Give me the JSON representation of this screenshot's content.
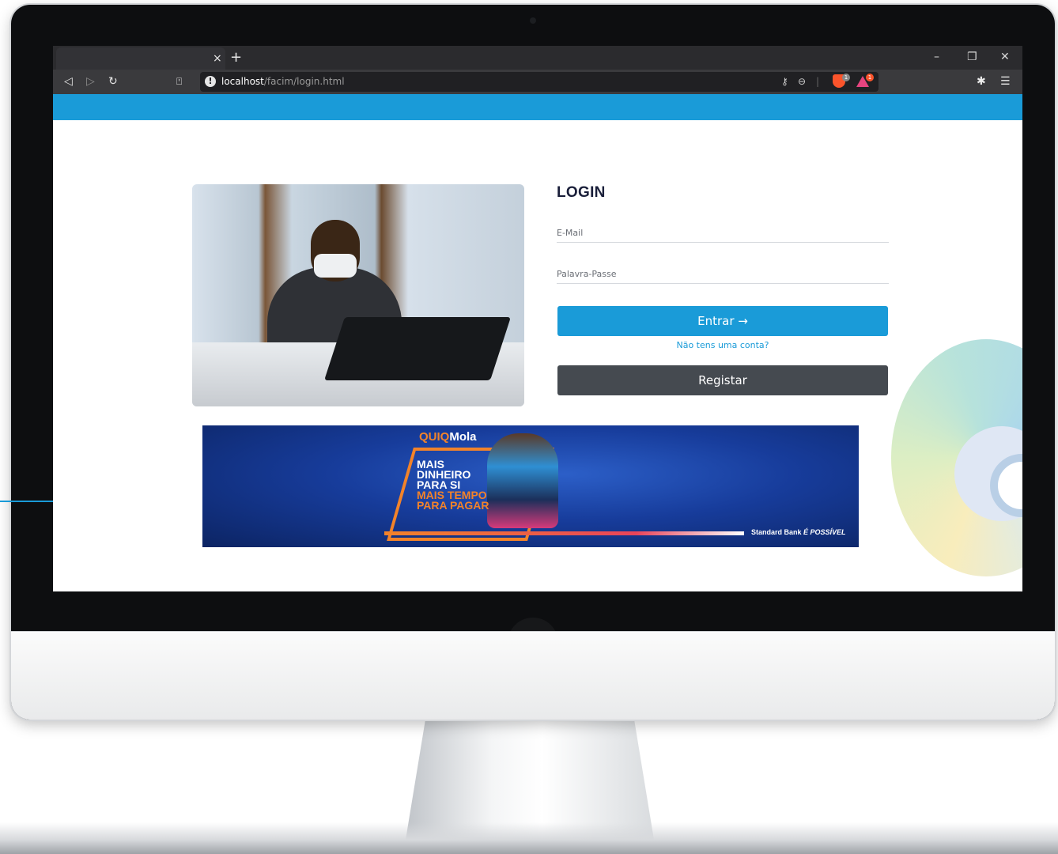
{
  "browser": {
    "tab_close": "×",
    "new_tab": "+",
    "url_host": "localhost",
    "url_path": "/facim/login.html",
    "brave_shields_count": "1",
    "rewards_count": "1",
    "window_controls": {
      "minimize": "–",
      "restore": "❐",
      "close": "✕"
    },
    "nav": {
      "back": "◁",
      "forward": "▷",
      "reload": "↻",
      "bookmark": "⍞"
    },
    "url_icons": {
      "key": "⚷",
      "zoom": "⊖",
      "divider": "|"
    },
    "extensions_icon": "✱",
    "menu_icon": "☰"
  },
  "login": {
    "title": "LOGIN",
    "email_placeholder": "E-Mail",
    "password_placeholder": "Palavra-Passe",
    "enter_label": "Entrar →",
    "no_account_link": "Não tens uma conta?",
    "register_label": "Registar"
  },
  "banner": {
    "brand_prefix": "QUIQ",
    "brand_suffix": "Mola",
    "line1": "MAIS",
    "line2": "DINHEIRO",
    "line3": "PARA SI",
    "line4": "MAIS TEMPO",
    "line5": "PARA PAGAR",
    "sponsor": "Standard Bank",
    "tagline": "É POSSÍVEL"
  },
  "scrollbar": {
    "left_arrow": "◂",
    "right_arrow": "▸"
  },
  "colors": {
    "accent": "#1a9bd8",
    "register": "#454a50",
    "banner_orange": "#f2832a"
  }
}
